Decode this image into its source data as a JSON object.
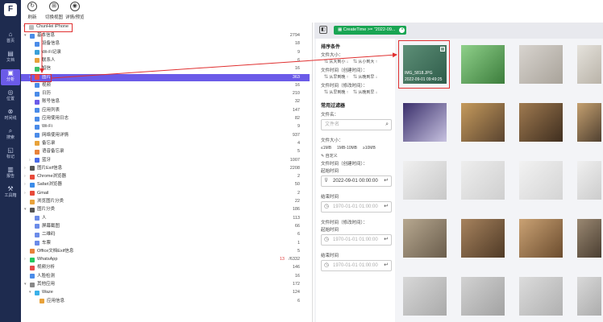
{
  "colors": {
    "rail_bg": "#1e2b4f",
    "accent": "#6b5be8",
    "chip_green": "#19a553",
    "annotation_red": "#e03030"
  },
  "rail": [
    {
      "icon": "home-icon",
      "glyph": "⌂",
      "label": "首页"
    },
    {
      "icon": "document-icon",
      "glyph": "▤",
      "label": "文档"
    },
    {
      "icon": "analysis-icon",
      "glyph": "▣",
      "label": "分析"
    },
    {
      "icon": "location-icon",
      "glyph": "◎",
      "label": "位置"
    },
    {
      "icon": "timeline-icon",
      "glyph": "⊗",
      "label": "时间线"
    },
    {
      "icon": "search-icon",
      "glyph": "⌕",
      "label": "搜索"
    },
    {
      "icon": "bookmark-icon",
      "glyph": "◱",
      "label": "标记"
    },
    {
      "icon": "report-icon",
      "glyph": "▥",
      "label": "报告"
    },
    {
      "icon": "toolbox-icon",
      "glyph": "⚒",
      "label": "工具箱"
    }
  ],
  "toolbar": [
    {
      "icon": "refresh-icon",
      "glyph": "↻",
      "label": "刷新"
    },
    {
      "icon": "switch-view-icon",
      "glyph": "⊞",
      "label": "切换视图"
    },
    {
      "icon": "eye-icon",
      "glyph": "◉",
      "label": "详情/预览"
    }
  ],
  "tree": {
    "device": "ChunHei iPhone",
    "rows": [
      {
        "label": "基本信息",
        "count": "2794"
      },
      {
        "label": "设备信息",
        "count": "18"
      },
      {
        "label": "Wi-Fi记录",
        "count": "9"
      },
      {
        "label": "联系人",
        "count": "6"
      },
      {
        "label": "短信",
        "count": "16"
      },
      {
        "label": "图片",
        "count": "363"
      },
      {
        "label": "视频",
        "count": "16"
      },
      {
        "label": "日历",
        "count": "210"
      },
      {
        "label": "账号信息",
        "count": "32"
      },
      {
        "label": "应用列表",
        "count": "147"
      },
      {
        "label": "应用使用日志",
        "count": "82"
      },
      {
        "label": "Wi-Fi",
        "count": "9"
      },
      {
        "label": "网络使用详情",
        "count": "937"
      },
      {
        "label": "备忘录",
        "count": "4"
      },
      {
        "label": "语音备忘录",
        "count": "5"
      },
      {
        "label": "蓝牙",
        "count": "1007"
      },
      {
        "label": "图片Exif信息",
        "count": "2208"
      },
      {
        "label": "Chrome浏览器",
        "count": "2"
      },
      {
        "label": "Safari浏览器",
        "count": "50"
      },
      {
        "label": "Gmail",
        "count": "2"
      },
      {
        "label": "浏览图片分类",
        "count": "22"
      },
      {
        "label": "图片分类",
        "count": "186"
      },
      {
        "label": "人",
        "count": "113"
      },
      {
        "label": "屏幕截图",
        "count": "66"
      },
      {
        "label": "二维码",
        "count": "6"
      },
      {
        "label": "车票",
        "count": "1"
      },
      {
        "label": "Office文档Exif信息",
        "count": "5"
      },
      {
        "label": "WhatsApp",
        "count": "/6332",
        "count_red": "13"
      },
      {
        "label": "视频分析",
        "count": "146"
      },
      {
        "label": "人脸检测",
        "count": "16"
      },
      {
        "label": "其他应用",
        "count": "172"
      },
      {
        "label": "Waze",
        "count": "124"
      },
      {
        "label": "应用信息",
        "count": "6"
      }
    ]
  },
  "filter_chip": "CreateTime >= \"2022-09...",
  "filters": {
    "sort_title": "排序条件",
    "size_label": "文件大小：",
    "size_asc": "从大到小",
    "size_desc": "从小到大",
    "ctime_label": "文件时间（创建时间）：",
    "mtime_label": "文件时间（修改时间）：",
    "early_first": "从早到晚",
    "late_first": "从晚到早",
    "common_title": "常用过滤器",
    "name_label": "文件名：",
    "name_placeholder": "文件名",
    "size_filter_label": "文件大小：",
    "size_small": "≤1MB",
    "size_mid": "1MB-10MB",
    "size_large": "≥10MB",
    "custom": "自定义",
    "ctime_filter_label": "文件时间（创建时间）：",
    "start_label": "起始时间",
    "ctime_start": "2022-09-01 00:00:00",
    "end_label": "结束时间",
    "ctime_end": "1970-01-01 01:00:00",
    "mtime_filter_label": "文件时间（修改时间）：",
    "mtime_start": "1970-01-01 01:00:00",
    "mtime_end": "1970-01-01 01:00:00"
  },
  "thumbnails": [
    {
      "name": "IMG_5818.JPG",
      "date": "2022-09-01 09:49:25",
      "c1": "#5d8f77",
      "c2": "#2f5c4a"
    },
    {
      "c1": "#8fd08a",
      "c2": "#3c7d3c"
    },
    {
      "c1": "#d8d4cf",
      "c2": "#a9a39a"
    },
    {
      "c1": "#e5e2dc",
      "c2": "#b9b3a8"
    },
    {
      "c1": "#3a2f6b",
      "c2": "#c7c2e0"
    },
    {
      "c1": "#c59a5c",
      "c2": "#5a4430"
    },
    {
      "c1": "#9f7a50",
      "c2": "#3f2e1f"
    },
    {
      "c1": "#c4a070",
      "c2": "#504030"
    },
    {
      "c1": "#f0f0f0",
      "c2": "#c8c8c8"
    },
    {
      "c1": "#eeeeee",
      "c2": "#cfcfcf"
    },
    {
      "c1": "#f2f2f2",
      "c2": "#d4d4d4"
    },
    {
      "c1": "#f0f0f0",
      "c2": "#cccccc"
    },
    {
      "c1": "#b7a890",
      "c2": "#6a5d4c"
    },
    {
      "c1": "#a7835e",
      "c2": "#4f3a26"
    },
    {
      "c1": "#caa274",
      "c2": "#6b4c2e"
    },
    {
      "c1": "#9a8872",
      "c2": "#4a3e31"
    },
    {
      "c1": "#d8d8d8",
      "c2": "#aaaaaa"
    },
    {
      "c1": "#d2d2d2",
      "c2": "#a2a2a2"
    },
    {
      "c1": "#dcdcdc",
      "c2": "#b0b0b0"
    },
    {
      "c1": "#d9d9d9",
      "c2": "#acacac"
    }
  ]
}
